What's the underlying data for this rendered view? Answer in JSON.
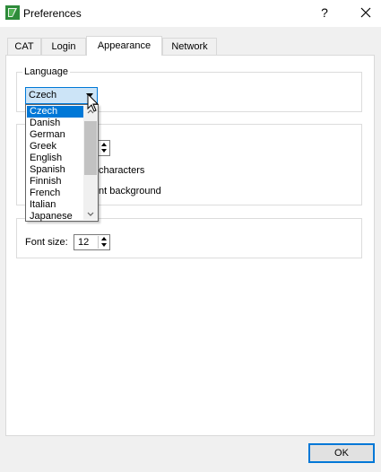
{
  "window": {
    "title": "Preferences",
    "help": "?",
    "accent_color": "#0078d7"
  },
  "tabs": [
    {
      "label": "CAT"
    },
    {
      "label": "Login"
    },
    {
      "label": "Appearance"
    },
    {
      "label": "Network"
    }
  ],
  "active_tab": "Appearance",
  "language": {
    "legend": "Language",
    "selected": "Czech",
    "options": [
      "Czech",
      "Danish",
      "German",
      "Greek",
      "English",
      "Spanish",
      "Finnish",
      "French",
      "Italian",
      "Japanese"
    ]
  },
  "editor_group": {
    "checkbox1_partial_label": "characters",
    "checkbox2_partial_label": "nt background"
  },
  "font_group": {
    "font_size_label": "Font size:",
    "font_size_value": "12"
  },
  "buttons": {
    "ok": "OK"
  }
}
